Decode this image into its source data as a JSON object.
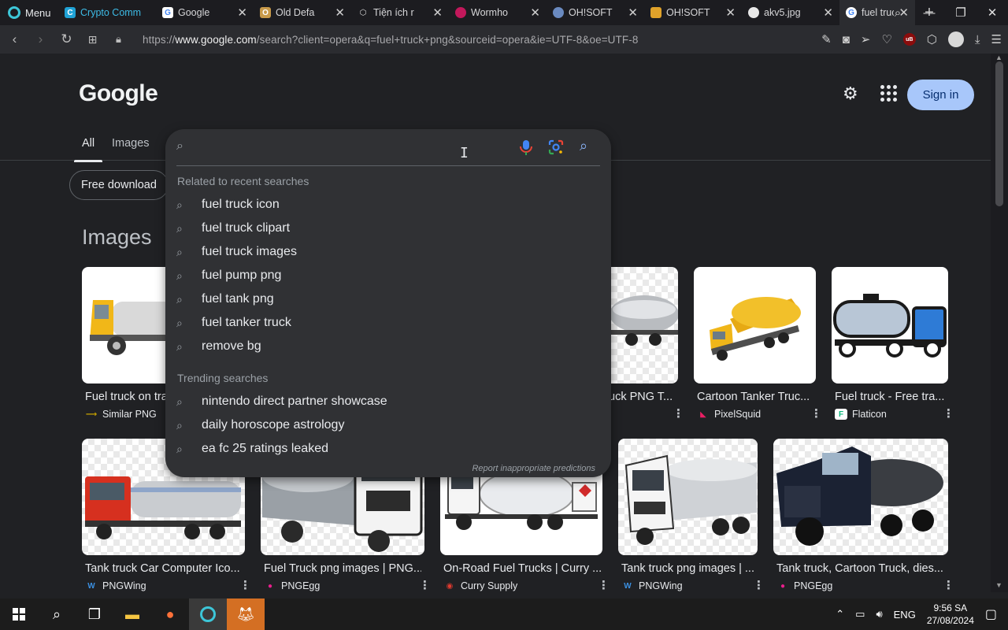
{
  "browser": {
    "menu_label": "Menu",
    "tabs": [
      {
        "title": "Crypto Comm",
        "color": "#1fa2d6",
        "glyph": "C"
      },
      {
        "title": "Google",
        "color": "#ffffff",
        "glyph": "G"
      },
      {
        "title": "Old Defa",
        "color": "#c89a4a",
        "glyph": "O"
      },
      {
        "title": "Tiện ích r",
        "color": "#cfcfcf",
        "glyph": "◇"
      },
      {
        "title": "Wormho",
        "color": "#c2185b",
        "glyph": "W"
      },
      {
        "title": "OH!SOFT",
        "color": "#6a8ac0",
        "glyph": "O"
      },
      {
        "title": "OH!SOFT",
        "color": "#e0a22a",
        "glyph": "O"
      },
      {
        "title": "akv5.jpg",
        "color": "#e8e8e8",
        "glyph": "●"
      },
      {
        "title": "fuel truc",
        "color": "#ffffff",
        "glyph": "G",
        "active": true
      }
    ],
    "url_prefix": "https://",
    "url_host": "www.google.com",
    "url_path": "/search?client=opera&q=fuel+truck+png&sourceid=opera&ie=UTF-8&oe=UTF-8"
  },
  "page": {
    "logo": "Google",
    "signin_label": "Sign in",
    "search_tabs": {
      "all": "All",
      "images": "Images"
    },
    "chip": "Free download",
    "images_heading": "Images",
    "search": {
      "value": "",
      "related_heading": "Related to recent searches",
      "related": [
        "fuel truck icon",
        "fuel truck clipart",
        "fuel truck images",
        "fuel pump png",
        "fuel tank png",
        "fuel tanker truck",
        "remove bg"
      ],
      "trending_heading": "Trending searches",
      "trending": [
        "nintendo direct partner showcase",
        "daily horoscope astrology",
        "ea fc 25 ratings leaked"
      ],
      "report_link": "Report inappropriate predictions"
    },
    "row1": [
      {
        "title": "Fuel truck on tra",
        "source": "Similar PNG",
        "icon": "similarpng-icon",
        "src_color": "#c8a200"
      },
      {
        "title": "uck PNG T...",
        "source": "",
        "icon": "",
        "src_color": ""
      },
      {
        "title": "Cartoon Tanker Truc...",
        "source": "PixelSquid",
        "icon": "pixelsquid-icon",
        "src_color": "#e91e63"
      },
      {
        "title": "Fuel truck - Free tra...",
        "source": "Flaticon",
        "icon": "flaticon-icon",
        "src_color": "#0fba7e"
      }
    ],
    "row2": [
      {
        "title": "Tank truck Car Computer Ico...",
        "source": "PNGWing",
        "icon": "pngwing-icon",
        "src_color": "#3b8fe0"
      },
      {
        "title": "Fuel Truck png images | PNG...",
        "source": "PNGEgg",
        "icon": "pngegg-icon",
        "src_color": "#e91e8c"
      },
      {
        "title": "On-Road Fuel Trucks | Curry ...",
        "source": "Curry Supply",
        "icon": "curry-supply-icon",
        "src_color": "#e03a2f"
      },
      {
        "title": "Tank truck png images | ...",
        "source": "PNGWing",
        "icon": "pngwing-icon",
        "src_color": "#3b8fe0"
      },
      {
        "title": "Tank truck, Cartoon Truck, dies...",
        "source": "PNGEgg",
        "icon": "pngegg-icon",
        "src_color": "#e91e8c"
      }
    ]
  },
  "taskbar": {
    "language": "ENG",
    "time": "9:56 SA",
    "date": "27/08/2024"
  }
}
